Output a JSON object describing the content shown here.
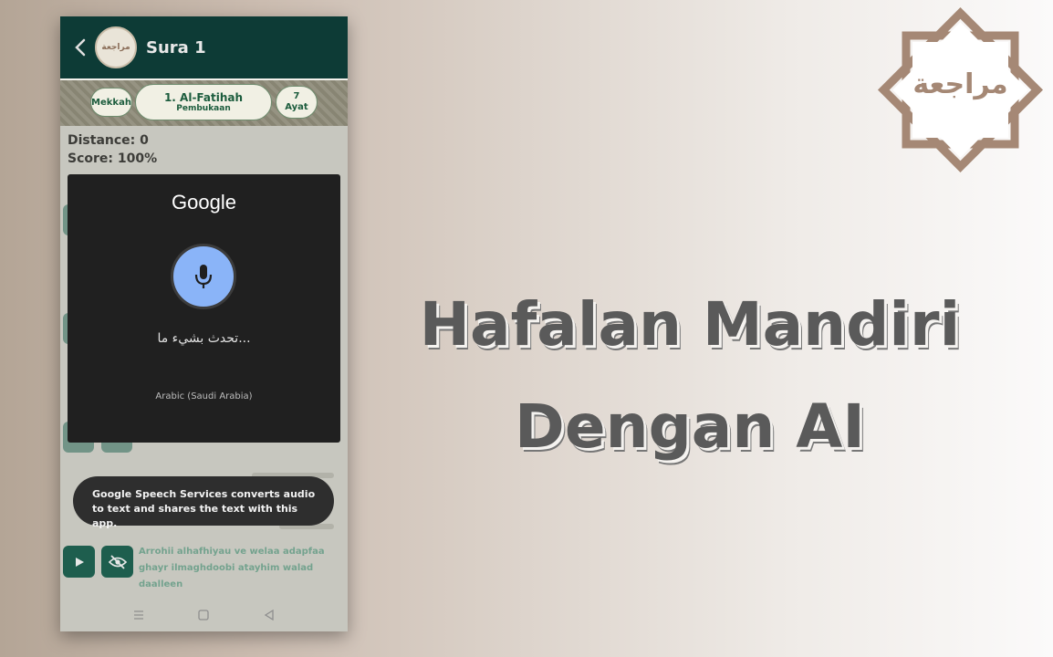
{
  "app": {
    "header_title": "Sura 1",
    "logo_text": "مراجعة"
  },
  "sura": {
    "place": "Mekkah",
    "name": "1. Al-Fatihah",
    "meaning": "Pembukaan",
    "ayat_count": "7",
    "ayat_label": "Ayat"
  },
  "stats": {
    "distance": "Distance: 0",
    "score": "Score: 100%"
  },
  "speech_dialog": {
    "brand": "Google",
    "prompt": "تحدث بشيء ما...",
    "language": "Arabic (Saudi Arabia)"
  },
  "toast": {
    "message": "Google Speech Services converts audio to text and shares the text with this app."
  },
  "verse": {
    "latin": "Arrohii alhafhiyau ve welaa adapfaa ghayr ilmaghdoobi atayhim walad daalleen"
  },
  "hero": {
    "line1": "Hafalan Mandiri",
    "line2": "Dengan AI"
  },
  "stamp": {
    "text": "مراجعة"
  },
  "colors": {
    "header_green": "#0d3b36",
    "mic_blue": "#8ab4f8",
    "stamp_brown": "#a58875"
  }
}
